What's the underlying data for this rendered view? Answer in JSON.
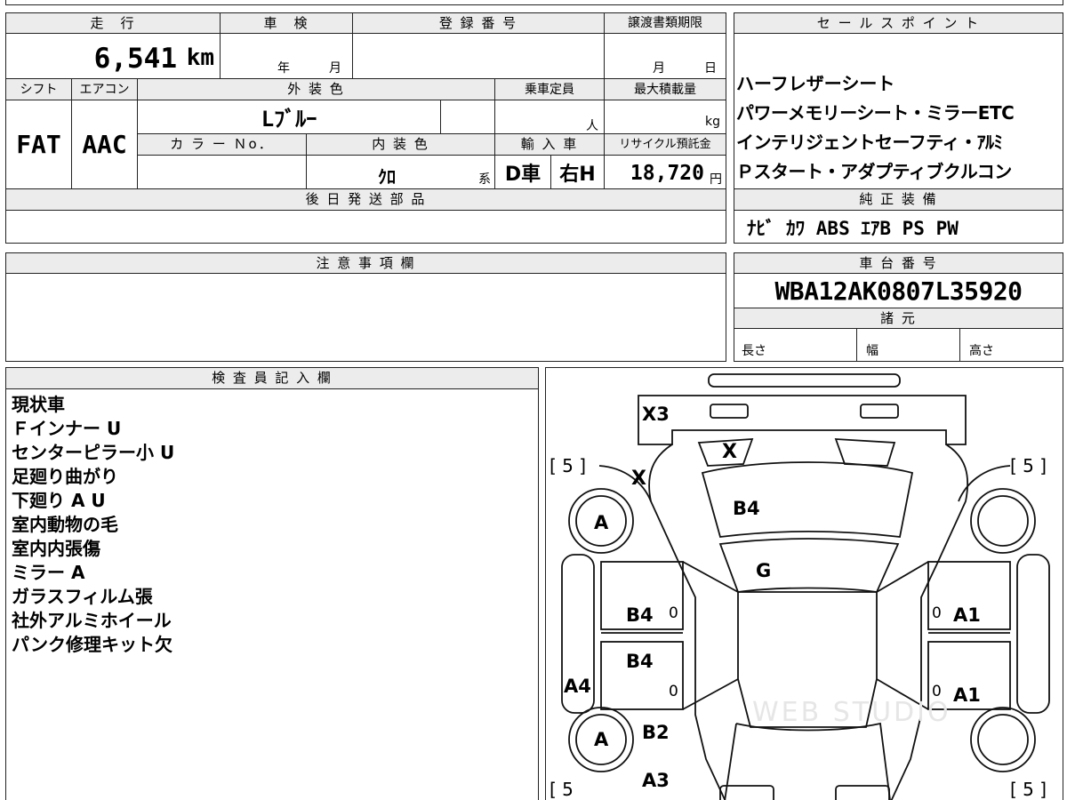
{
  "vehicle": {
    "headers": {
      "mileage": "走　行",
      "inspection": "車　検",
      "registration": "登 録 番 号",
      "transfer_deadline": "譲渡書類期限",
      "shift": "シフト",
      "aircon": "エアコン",
      "exterior_color": "外 装 色",
      "capacity": "乗車定員",
      "max_load": "最大積載量",
      "color_no": "カ ラ ー Ｎo．",
      "interior_color": "内 装 色",
      "import": "輸 入 車",
      "recycle": "リサイクル預託金",
      "later_parts": "後 日 発 送 部 品"
    },
    "mileage": "6,541",
    "mileage_unit": "km",
    "inspection_year_label": "年",
    "inspection_month_label": "月",
    "transfer_month_label": "月",
    "transfer_day_label": "日",
    "shift": "FAT",
    "aircon": "AAC",
    "exterior_color": "Lﾌﾞﾙｰ",
    "capacity_unit": "人",
    "max_load_unit": "kg",
    "interior_color": "ｸﾛ",
    "interior_suffix": "系",
    "import_type": "D車",
    "handle": "右H",
    "recycle_fee": "18,720",
    "recycle_unit": "円"
  },
  "sales_points": {
    "header": "セ ー ル ス ポ イ ン ト",
    "lines": [
      "ハーフレザーシート",
      "パワーメモリーシート・ミラーETC",
      "インテリジェントセーフティ・ｱﾙﾐ",
      "Ｐスタート・アダプティブクルコン"
    ]
  },
  "genuine_equipment": {
    "header": "純 正 装 備",
    "value": "ﾅﾋﾞ ｶﾜ ABS ｴｱB PS PW"
  },
  "caution": {
    "header": "注 意 事 項 欄"
  },
  "chassis": {
    "header": "車 台 番 号",
    "number": "WBA12AK0807L35920",
    "spec_header": "諸 元",
    "length_label": "長さ",
    "width_label": "幅",
    "height_label": "高さ"
  },
  "inspector": {
    "header": "検 査 員 記 入 欄",
    "notes": [
      "現状車",
      "Ｆインナー U",
      "センターピラー小 U",
      "足廻り曲がり",
      "下廻り A U",
      "室内動物の毛",
      "室内内張傷",
      "ミラー A",
      "ガラスフィルム張",
      "社外アルミホイール",
      "パンク修理キット欠"
    ]
  },
  "diagram": {
    "tread_tl": "[ 5 ]",
    "tread_tr": "[ 5 ]",
    "tread_bl": "[ 5",
    "tread_br": "[ 5 ]",
    "marks": {
      "x3": "X3",
      "x_front": "X",
      "x_fender": "X",
      "b4_hood": "B4",
      "g_glass": "G",
      "b4_left_front": "B4",
      "b4_left_rear": "B4",
      "a1_right_front": "A1",
      "a1_right_rear": "A1",
      "a4": "A4",
      "b2": "B2",
      "a3": "A3",
      "a_wheel_front": "A",
      "a_wheel_rear": "A",
      "zero1": "0",
      "zero2": "0",
      "zero3": "0",
      "zero4": "0"
    },
    "watermark": "WEB STUDIO"
  }
}
